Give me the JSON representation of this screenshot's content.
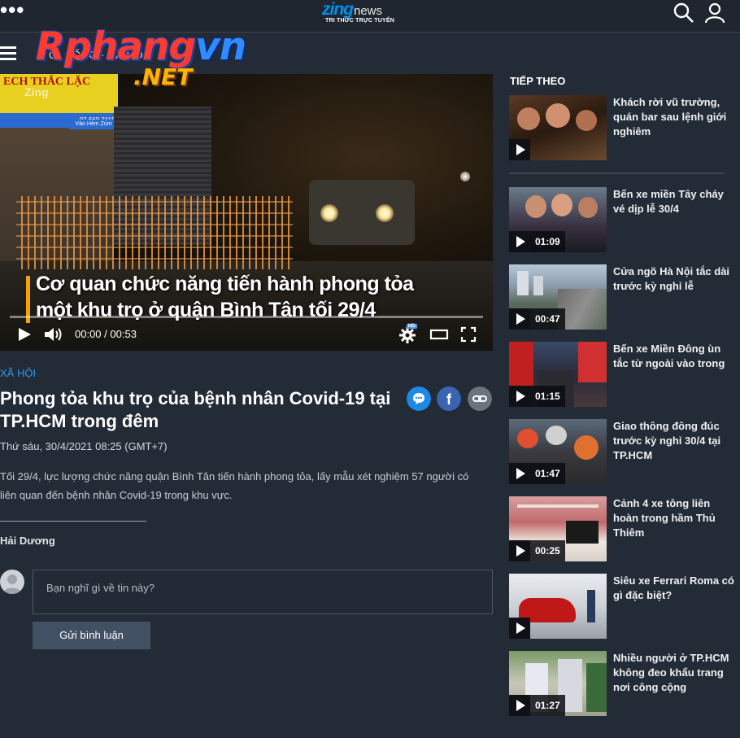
{
  "header": {
    "logo_main": "zing",
    "logo_sub": "news",
    "tagline": "TRI THỨC TRỰC TUYẾN",
    "search_icon": "search-icon",
    "user_icon": "user-icon",
    "more_icon": "more-dots-icon"
  },
  "watermark": {
    "brand_a": "Rphang",
    "brand_b": "vn",
    "suffix": ".NET"
  },
  "nav": {
    "crumb": "ỜI SỐNG · XÃ HỘI"
  },
  "video": {
    "watermark": "Zing",
    "sign_text": "ECH THẮC LẶC",
    "sign_phone": "07.669.2111",
    "sign_small": "Vào Hẻm Zúm",
    "caption_line1": "Cơ quan chức năng tiến hành phong tỏa",
    "caption_line2": "một khu trọ ở quận Bình Tân tối 29/4",
    "current_time": "00:00",
    "time_separator": "/",
    "duration": "00:53",
    "progress": 0.0,
    "hd_label": "HD"
  },
  "article": {
    "category": "XÃ HỘI",
    "title": "Phong tỏa khu trọ của bệnh nhân Covid-19 tại TP.HCM trong đêm",
    "date": "Thứ sáu, 30/4/2021 08:25 (GMT+7)",
    "sapo": "Tối 29/4, lực lượng chức năng quận Bình Tân tiến hành phong tỏa, lấy mẫu xét nghiệm 57 người có liên quan đến bệnh nhân Covid-19 trong khu vực.",
    "author": "Hải Dương"
  },
  "comment": {
    "placeholder": "Bạn nghĩ gì về tin này?",
    "submit": "Gửi bình luận"
  },
  "sidebar": {
    "heading": "TIẾP THEO",
    "items": [
      {
        "title": "Khách rời vũ trường, quán bar sau lệnh giới nghiêm",
        "duration": ""
      },
      {
        "title": "Bến xe miền Tây cháy vé dịp lễ 30/4",
        "duration": "01:09"
      },
      {
        "title": "Cửa ngõ Hà Nội tắc dài trước kỳ nghỉ lễ",
        "duration": "00:47"
      },
      {
        "title": "Bến xe Miền Đông ùn tắc từ ngoài vào trong",
        "duration": "01:15"
      },
      {
        "title": "Giao thông đông đúc trước kỳ nghỉ 30/4 tại TP.HCM",
        "duration": "01:47"
      },
      {
        "title": "Cảnh 4 xe tông liên hoàn trong hầm Thủ Thiêm",
        "duration": "00:25"
      },
      {
        "title": "Siêu xe Ferrari Roma có gì đặc biệt?",
        "duration": ""
      },
      {
        "title": "Nhiều người ở TP.HCM không đeo khẩu trang nơi công cộng",
        "duration": "01:27"
      }
    ]
  },
  "colors": {
    "background": "#232b36",
    "accent": "#2d97f2",
    "caption_bar": "#f4a300"
  }
}
